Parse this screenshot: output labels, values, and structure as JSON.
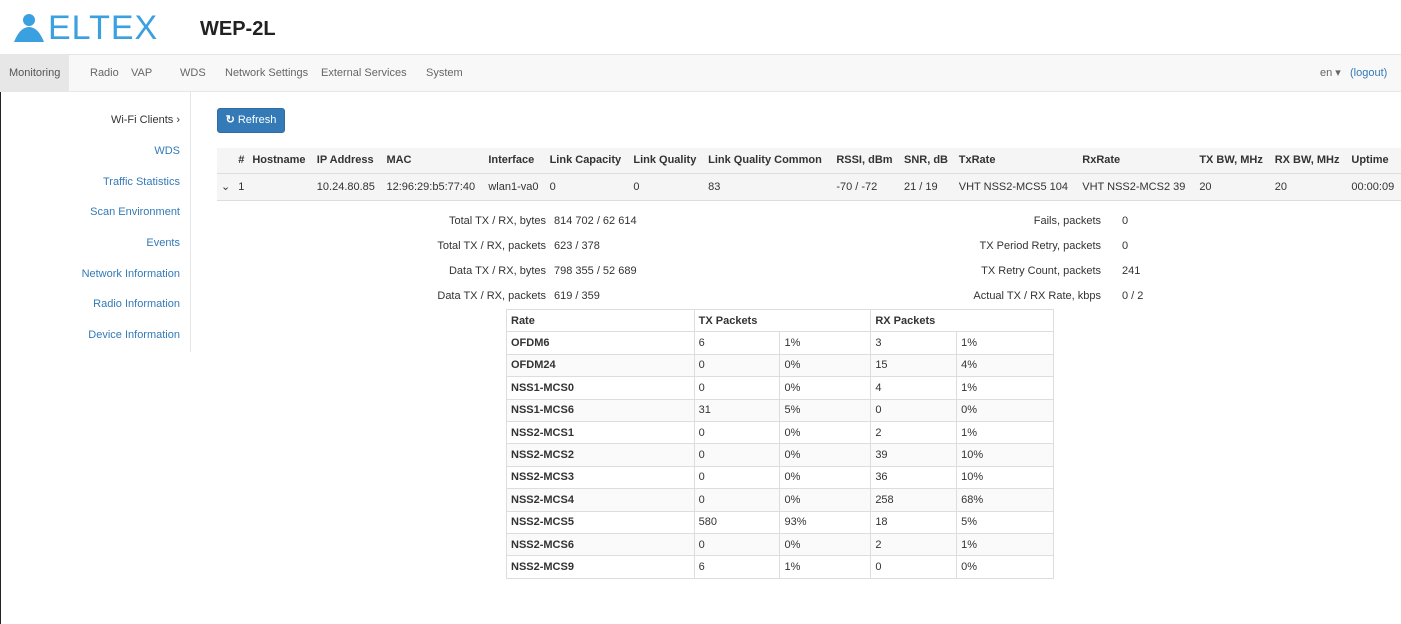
{
  "header": {
    "logo_text": "ELTEX",
    "model": "WEP-2L"
  },
  "nav": {
    "items": [
      "Monitoring",
      "Radio",
      "VAP",
      "WDS",
      "Network Settings",
      "External Services",
      "System"
    ],
    "lang": "en ▾",
    "logout": "(logout)"
  },
  "sidebar": {
    "items": [
      "Wi-Fi Clients ›",
      "WDS",
      "Traffic Statistics",
      "Scan Environment",
      "Events",
      "Network Information",
      "Radio Information",
      "Device Information"
    ]
  },
  "toolbar": {
    "refresh_label": "Refresh"
  },
  "clients": {
    "headers": [
      "",
      "#",
      "Hostname",
      "IP Address",
      "MAC",
      "Interface",
      "Link Capacity",
      "Link Quality",
      "Link Quality Common",
      "RSSI, dBm",
      "SNR, dB",
      "TxRate",
      "RxRate",
      "TX BW, MHz",
      "RX BW, MHz",
      "Uptime"
    ],
    "rows": [
      [
        "⌄",
        "1",
        "",
        "10.24.80.85",
        "12:96:29:b5:77:40",
        "wlan1-va0",
        "0",
        "0",
        "83",
        "-70 / -72",
        "21 / 19",
        "VHT NSS2-MCS5 104",
        "VHT NSS2-MCS2 39",
        "20",
        "20",
        "00:00:09"
      ]
    ]
  },
  "details": {
    "left": [
      {
        "label": "Total TX / RX, bytes",
        "value": "814 702 / 62 614"
      },
      {
        "label": "Total TX / RX, packets",
        "value": "623 / 378"
      },
      {
        "label": "Data TX / RX, bytes",
        "value": "798 355 / 52 689"
      },
      {
        "label": "Data TX / RX, packets",
        "value": "619 / 359"
      }
    ],
    "right": [
      {
        "label": "Fails, packets",
        "value": "0"
      },
      {
        "label": "TX Period Retry, packets",
        "value": "0"
      },
      {
        "label": "TX Retry Count, packets",
        "value": "241"
      },
      {
        "label": "Actual TX / RX Rate, kbps",
        "value": "0 / 2"
      }
    ]
  },
  "rates": {
    "headers": [
      "Rate",
      "TX Packets",
      "RX Packets"
    ],
    "rows": [
      [
        "OFDM6",
        "6",
        "1%",
        "3",
        "1%"
      ],
      [
        "OFDM24",
        "0",
        "0%",
        "15",
        "4%"
      ],
      [
        "NSS1-MCS0",
        "0",
        "0%",
        "4",
        "1%"
      ],
      [
        "NSS1-MCS6",
        "31",
        "5%",
        "0",
        "0%"
      ],
      [
        "NSS2-MCS1",
        "0",
        "0%",
        "2",
        "1%"
      ],
      [
        "NSS2-MCS2",
        "0",
        "0%",
        "39",
        "10%"
      ],
      [
        "NSS2-MCS3",
        "0",
        "0%",
        "36",
        "10%"
      ],
      [
        "NSS2-MCS4",
        "0",
        "0%",
        "258",
        "68%"
      ],
      [
        "NSS2-MCS5",
        "580",
        "93%",
        "18",
        "5%"
      ],
      [
        "NSS2-MCS6",
        "0",
        "0%",
        "2",
        "1%"
      ],
      [
        "NSS2-MCS9",
        "6",
        "1%",
        "0",
        "0%"
      ]
    ]
  },
  "colors": {
    "brand": "#3aa0e0",
    "link": "#337ab7",
    "button": "#337ab7"
  }
}
